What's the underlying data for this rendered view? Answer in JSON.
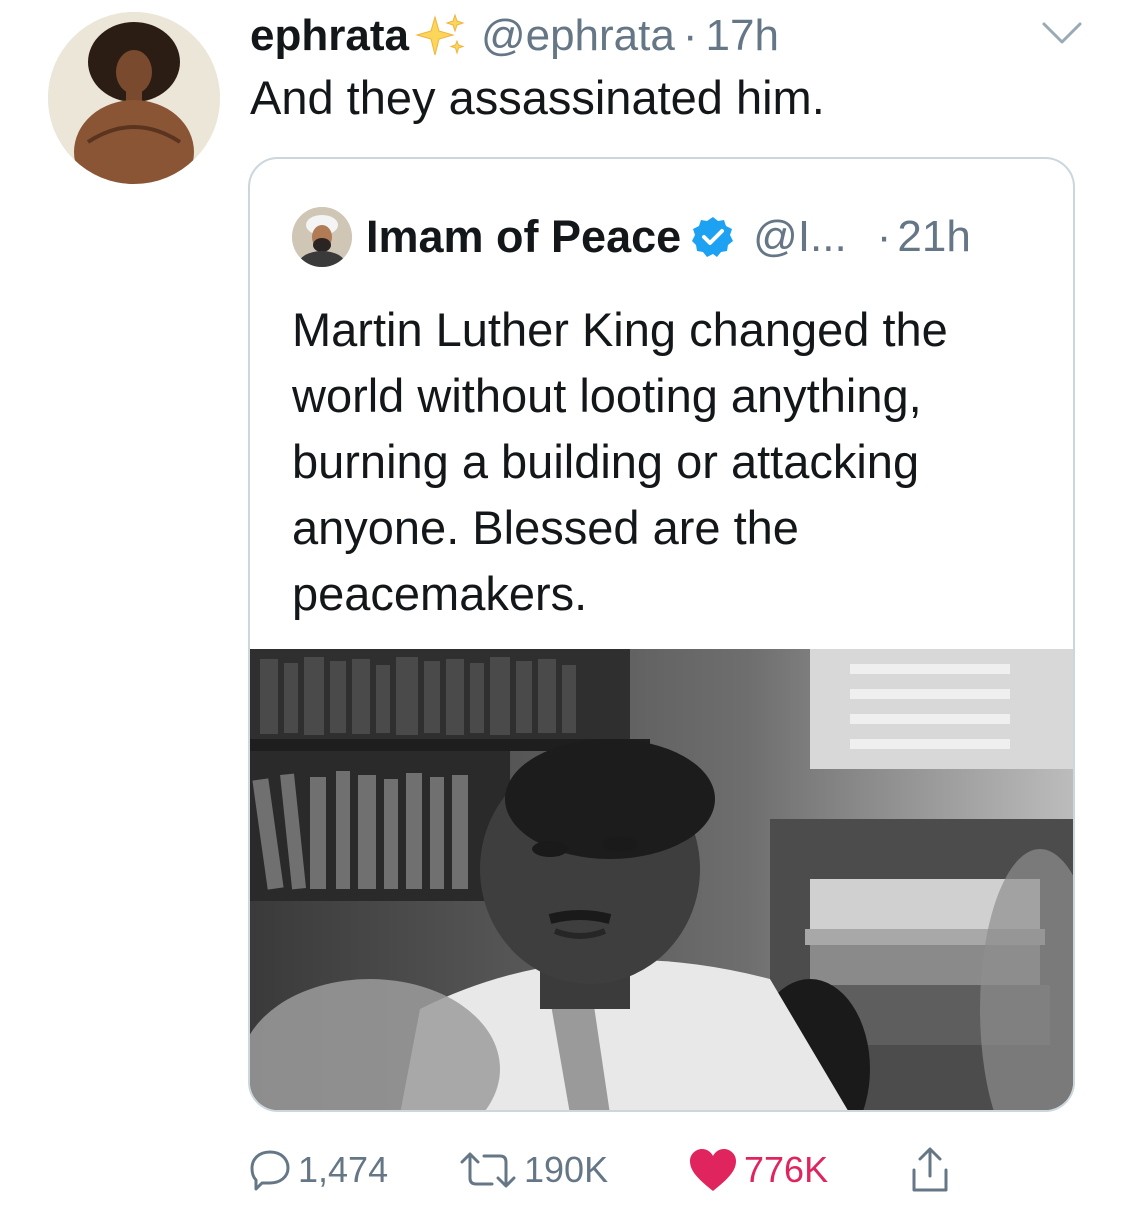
{
  "tweet": {
    "display_name": "ephrata",
    "handle": "@ephrata",
    "separator": "·",
    "time": "17h",
    "text": "And they assassinated him."
  },
  "quoted": {
    "display_name": "Imam of Peace",
    "handle": "@I...",
    "separator": "·",
    "time": "21h",
    "text": "Martin Luther King changed the world without looting anything, burning a building or attacking anyone. Blessed are the peacemakers."
  },
  "actions": {
    "replies": "1,474",
    "retweets": "190K",
    "likes": "776K"
  },
  "icons": {
    "sparkles": "sparkles-emoji",
    "verified": "verified-badge-icon",
    "caret": "chevron-down-icon",
    "reply": "reply-icon",
    "retweet": "retweet-icon",
    "like": "heart-icon",
    "share": "share-icon"
  },
  "colors": {
    "text_primary": "#14171a",
    "text_secondary": "#657786",
    "verified_blue": "#1da1f2",
    "like_red": "#e0245e",
    "border": "#ccd6dd"
  }
}
